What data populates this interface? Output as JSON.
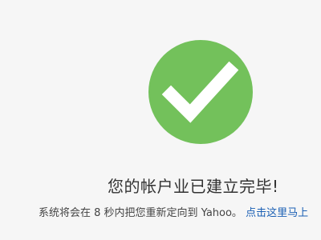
{
  "success": {
    "icon": "checkmark-icon",
    "color": "#73c15b"
  },
  "headline": "您的帐户业已建立完毕!",
  "redirect": {
    "text": "系统将会在 8 秒内把您重新定向到 Yahoo。",
    "link_label": "点击这里马上"
  }
}
